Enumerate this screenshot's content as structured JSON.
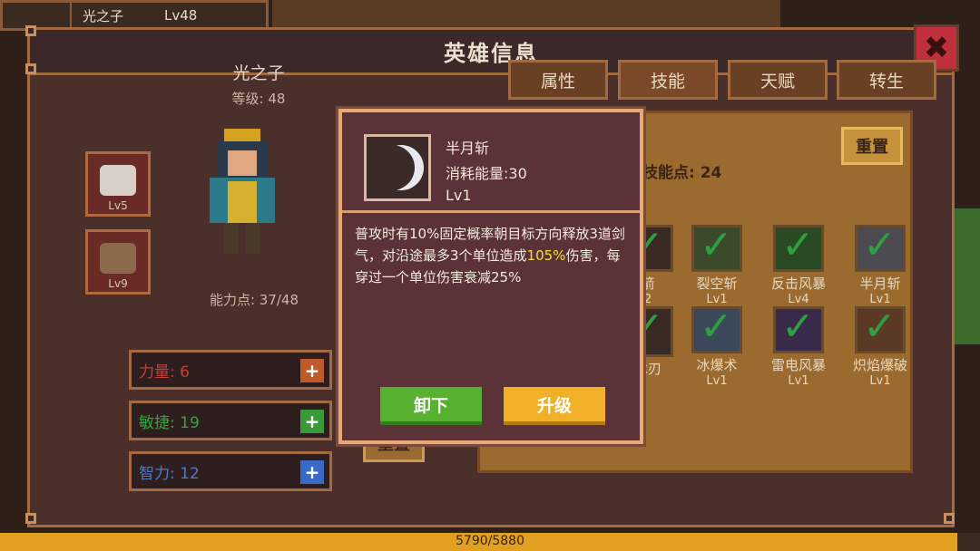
{
  "player": {
    "name": "光之子",
    "level": "Lv48"
  },
  "window": {
    "title": "英雄信息",
    "close": "✖"
  },
  "hero": {
    "name": "光之子",
    "level_label": "等级: 48",
    "equipment": [
      {
        "lv": "Lv5"
      },
      {
        "lv": "Lv9"
      }
    ],
    "ability_points": "能力点: 37/48",
    "stats": [
      {
        "label": "力量: 6",
        "color": "#c0403a",
        "plus_color": "#c05a2a"
      },
      {
        "label": "敏捷: 19",
        "color": "#3aa040",
        "plus_color": "#3a9a3a"
      },
      {
        "label": "智力: 12",
        "color": "#4a7ad0",
        "plus_color": "#3a6ac8"
      }
    ],
    "reset_label": "重置"
  },
  "tabs": [
    {
      "label": "属性"
    },
    {
      "label": "技能"
    },
    {
      "label": "天赋"
    },
    {
      "label": "转生"
    }
  ],
  "skills": {
    "points_label": "技能点: 24",
    "reset_label": "重置",
    "grid": [
      {
        "name": "箭",
        "lv": "2"
      },
      {
        "name": "裂空斩",
        "lv": "Lv1",
        "icon_color": "#6a9a4a"
      },
      {
        "name": "反击风暴",
        "lv": "Lv4",
        "icon_color": "#4a8a3a"
      },
      {
        "name": "半月斩",
        "lv": "Lv1",
        "icon_color": "#9a9aa8"
      },
      {
        "name": "冰刃",
        "lv": ""
      },
      {
        "name": "冰爆术",
        "lv": "Lv1",
        "icon_color": "#7ab0d8"
      },
      {
        "name": "雷电风暴",
        "lv": "Lv1",
        "icon_color": "#8a5ac8"
      },
      {
        "name": "炽焰爆破",
        "lv": "Lv1",
        "icon_color": "#d86a2a"
      }
    ]
  },
  "popup": {
    "skill_name": "半月斩",
    "cost": "消耗能量:30",
    "level": "Lv1",
    "desc_part1": "普攻时有10%固定概率朝目标方向释放3道剑气，对沿途最多3个单位造成",
    "desc_highlight": "105%",
    "desc_part2": "伤害，每穿过一个单位伤害衰减25%",
    "unequip_label": "卸下",
    "upgrade_label": "升级"
  },
  "exp": {
    "text": "5790/5880",
    "progress": 0.977
  }
}
